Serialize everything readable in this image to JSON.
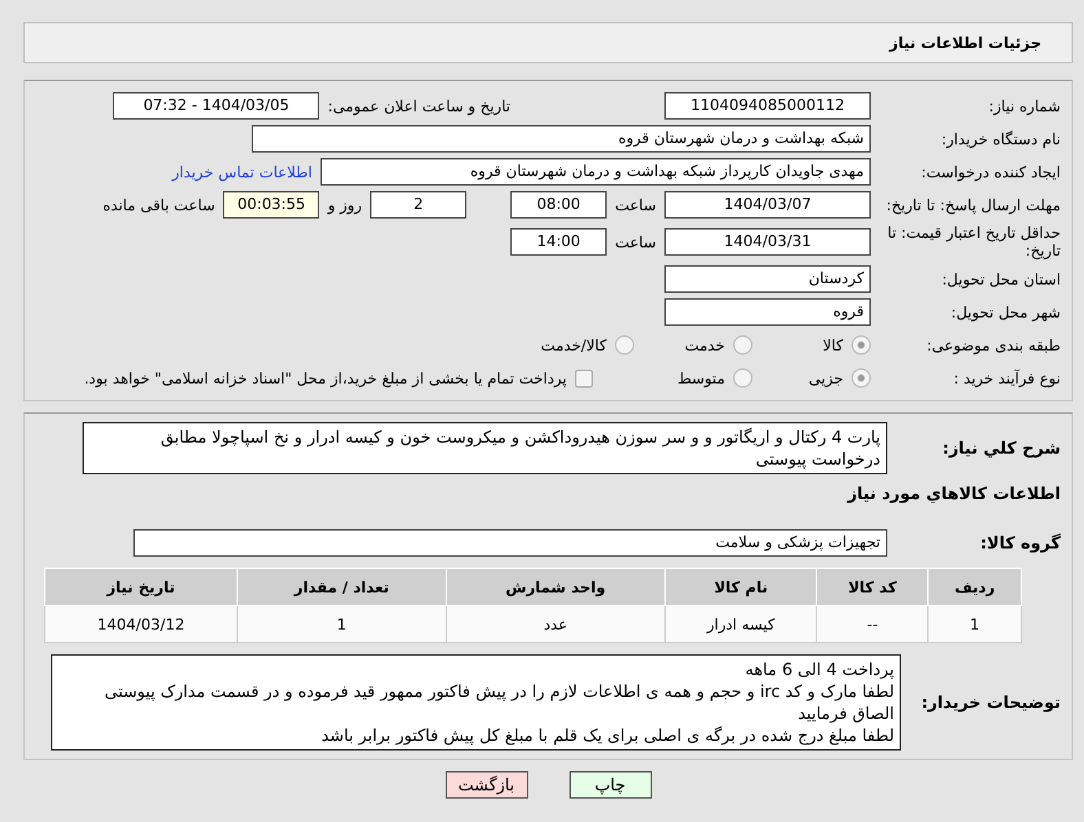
{
  "header": {
    "title": "جزئیات اطلاعات نیاز"
  },
  "need_number": {
    "label": "شماره نیاز:",
    "value": "1104094085000112"
  },
  "announce": {
    "label": "تاریخ و ساعت اعلان عمومی:",
    "value": "1404/03/05 - 07:32"
  },
  "buyer_org": {
    "label": "نام دستگاه خریدار:",
    "value": "شبکه بهداشت و درمان شهرستان قروه"
  },
  "creator": {
    "label": "ایجاد کننده درخواست:",
    "value": "مهدی جاویدان کارپرداز شبکه بهداشت و درمان شهرستان قروه",
    "link": "اطلاعات تماس خریدار"
  },
  "deadline": {
    "label": "مهلت ارسال پاسخ: تا تاریخ:",
    "date": "1404/03/07",
    "time_label": "ساعت",
    "time": "08:00",
    "days": "2",
    "days_label": "روز و",
    "remaining": "00:03:55",
    "remaining_label": "ساعت باقی مانده"
  },
  "validity": {
    "label": "حداقل تاریخ اعتبار قیمت: تا تاریخ:",
    "date": "1404/03/31",
    "time_label": "ساعت",
    "time": "14:00"
  },
  "province": {
    "label": "استان محل تحویل:",
    "value": "کردستان"
  },
  "city": {
    "label": "شهر محل تحویل:",
    "value": "قروه"
  },
  "category": {
    "label": "طبقه بندی موضوعی:",
    "options": [
      {
        "label": "کالا",
        "selected": true
      },
      {
        "label": "خدمت",
        "selected": false
      },
      {
        "label": "کالا/خدمت",
        "selected": false
      }
    ]
  },
  "process": {
    "label": "نوع فرآیند خرید :",
    "options": [
      {
        "label": "جزیی",
        "selected": true
      },
      {
        "label": "متوسط",
        "selected": false
      }
    ],
    "treasury": {
      "label": "پرداخت تمام یا بخشی از مبلغ خرید،از محل \"اسناد خزانه اسلامی\" خواهد بود.",
      "checked": false
    }
  },
  "description": {
    "label": "شرح کلي نياز:",
    "value": "پارت 4 رکتال و اریگاتور و و سر سوزن هیدروداکشن و میکروست خون و کیسه ادرار و نخ اسپاچولا مطابق درخواست پیوستی"
  },
  "goods_heading": "اطلاعات کالاهاي مورد نياز",
  "goods_group": {
    "label": "گروه کالا:",
    "value": "تجهیزات پزشکی و سلامت"
  },
  "table": {
    "columns": [
      "ردیف",
      "کد کالا",
      "نام کالا",
      "واحد شمارش",
      "تعداد / مقدار",
      "تاریخ نیاز"
    ],
    "rows": [
      [
        "1",
        "--",
        "کیسه ادرار",
        "عدد",
        "1",
        "1404/03/12"
      ]
    ]
  },
  "buyer_notes": {
    "label": "توضیحات خریدار:",
    "lines": [
      "پرداخت 4 الی 6 ماهه",
      "لطفا مارک و کد irc  و حجم و همه ی اطلاعات لازم را در پیش فاکتور ممهور قید فرموده و در قسمت مدارک پیوستی الصاق فرمایید",
      "لطفا مبلغ درج شده در برگه ی اصلی برای یک قلم با مبلغ کل پیش فاکتور برابر باشد"
    ]
  },
  "buttons": [
    {
      "kind": "print",
      "label": "چاپ"
    },
    {
      "kind": "back",
      "label": "بازگشت"
    }
  ]
}
